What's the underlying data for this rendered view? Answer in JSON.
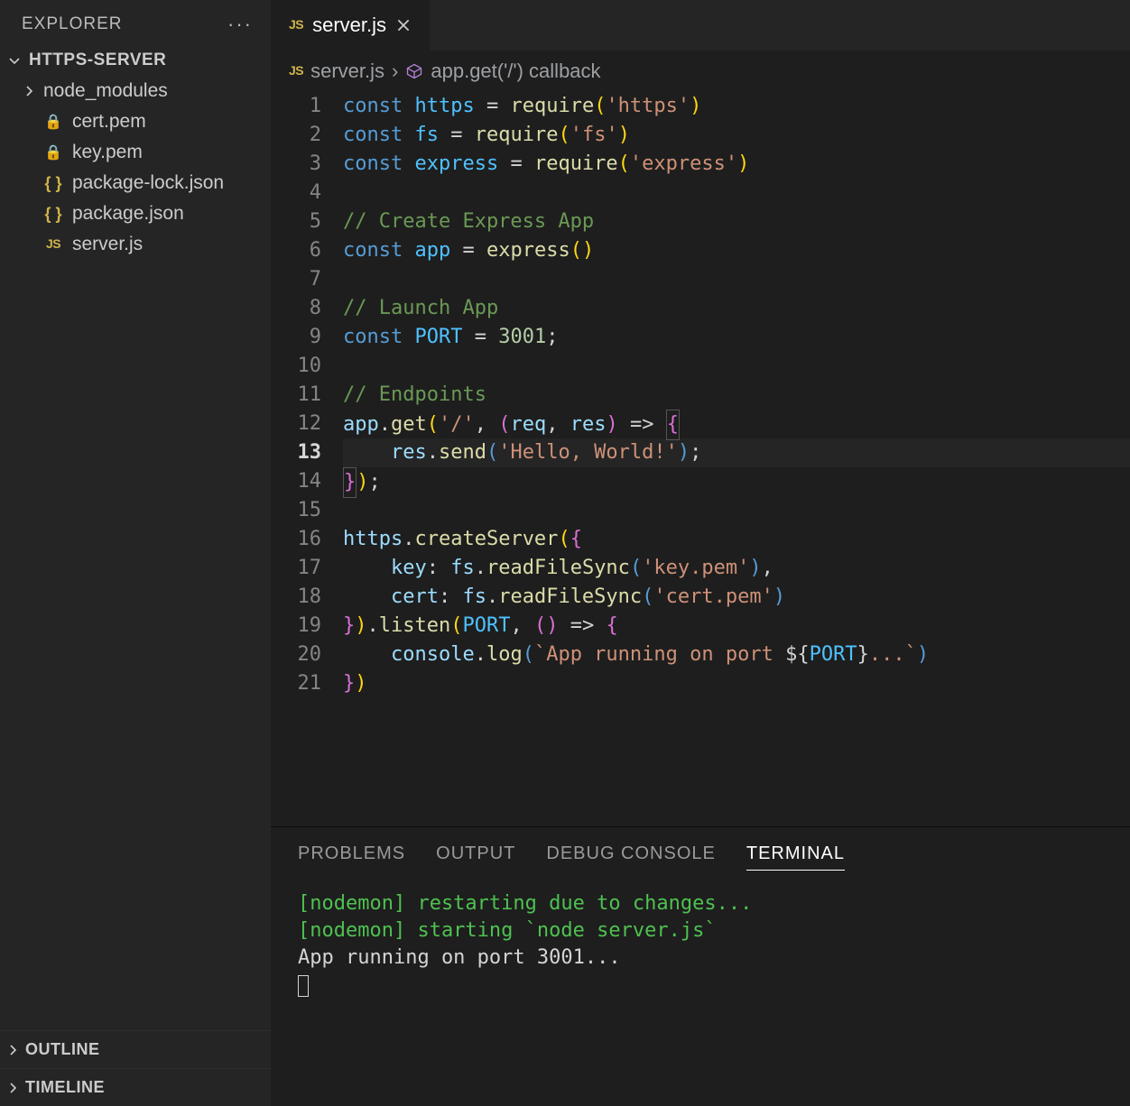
{
  "explorer": {
    "title": "EXPLORER",
    "project": "HTTPS-SERVER",
    "items": [
      {
        "kind": "folder",
        "label": "node_modules"
      },
      {
        "kind": "lock",
        "label": "cert.pem"
      },
      {
        "kind": "lock",
        "label": "key.pem"
      },
      {
        "kind": "braces",
        "label": "package-lock.json"
      },
      {
        "kind": "braces",
        "label": "package.json"
      },
      {
        "kind": "js",
        "label": "server.js"
      }
    ],
    "panels": [
      "OUTLINE",
      "TIMELINE"
    ]
  },
  "editor_tab": {
    "filename": "server.js"
  },
  "breadcrumb": {
    "file": "server.js",
    "symbol": "app.get('/') callback"
  },
  "code": {
    "lines": 21,
    "active_line": 13,
    "content": [
      "const https = require('https')",
      "const fs = require('fs')",
      "const express = require('express')",
      "",
      "// Create Express App",
      "const app = express()",
      "",
      "// Launch App",
      "const PORT = 3001;",
      "",
      "// Endpoints",
      "app.get('/', (req, res) => {",
      "    res.send('Hello, World!');",
      "});",
      "",
      "https.createServer({",
      "    key: fs.readFileSync('key.pem'),",
      "    cert: fs.readFileSync('cert.pem')",
      "}).listen(PORT, () => {",
      "    console.log(`App running on port ${PORT}...`)",
      "})"
    ]
  },
  "panel": {
    "tabs": [
      "PROBLEMS",
      "OUTPUT",
      "DEBUG CONSOLE",
      "TERMINAL"
    ],
    "active": "TERMINAL",
    "terminal_lines": [
      {
        "color": "green",
        "text": "[nodemon] restarting due to changes..."
      },
      {
        "color": "green",
        "text": "[nodemon] starting `node server.js`"
      },
      {
        "color": "",
        "text": "App running on port 3001..."
      }
    ]
  }
}
